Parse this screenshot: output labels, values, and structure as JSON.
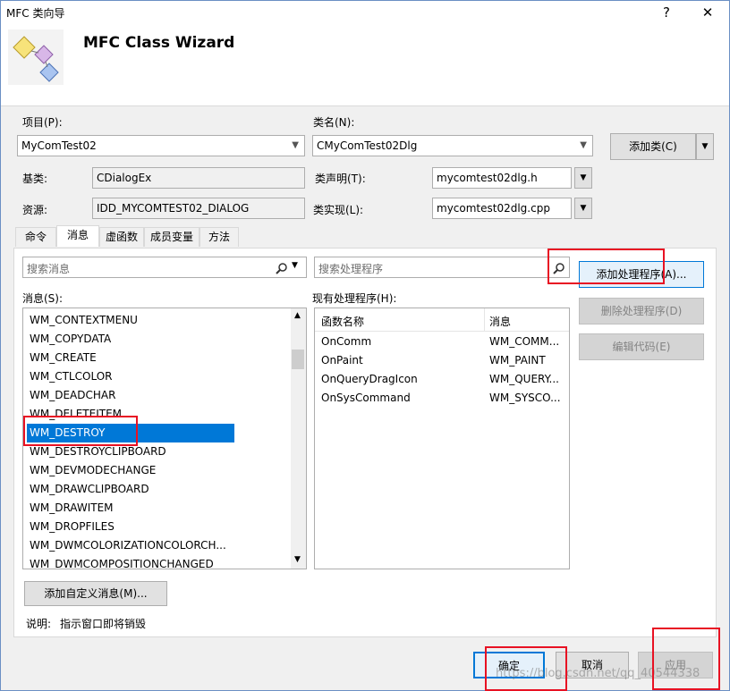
{
  "window": {
    "title": "MFC 类向导",
    "help": "?",
    "close": "✕"
  },
  "header": {
    "title": "MFC Class Wizard"
  },
  "project": {
    "label": "项目(P):",
    "value": "MyComTest02"
  },
  "classname": {
    "label": "类名(N):",
    "value": "CMyComTest02Dlg"
  },
  "add_class": {
    "label": "添加类(C)"
  },
  "base": {
    "label": "基类:",
    "value": "CDialogEx"
  },
  "class_decl": {
    "label": "类声明(T):",
    "value": "mycomtest02dlg.h"
  },
  "resource": {
    "label": "资源:",
    "value": "IDD_MYCOMTEST02_DIALOG"
  },
  "class_impl": {
    "label": "类实现(L):",
    "value": "mycomtest02dlg.cpp"
  },
  "tabs": [
    "命令",
    "消息",
    "虚函数",
    "成员变量",
    "方法"
  ],
  "search_messages": {
    "placeholder": "搜索消息"
  },
  "search_handlers": {
    "placeholder": "搜索处理程序"
  },
  "messages": {
    "label": "消息(S):",
    "items": [
      "WM_CONTEXTMENU",
      "WM_COPYDATA",
      "WM_CREATE",
      "WM_CTLCOLOR",
      "WM_DEADCHAR",
      "WM_DELETEITEM",
      "WM_DESTROY",
      "WM_DESTROYCLIPBOARD",
      "WM_DEVMODECHANGE",
      "WM_DRAWCLIPBOARD",
      "WM_DRAWITEM",
      "WM_DROPFILES",
      "WM_DWMCOLORIZATIONCOLORCH...",
      "WM_DWMCOMPOSITIONCHANGED"
    ],
    "selected": "WM_DESTROY"
  },
  "handlers": {
    "label": "现有处理程序(H):",
    "col_func": "函数名称",
    "col_msg": "消息",
    "rows": [
      {
        "func": "OnComm",
        "msg": "WM_COMM..."
      },
      {
        "func": "OnPaint",
        "msg": "WM_PAINT"
      },
      {
        "func": "OnQueryDragIcon",
        "msg": "WM_QUERY..."
      },
      {
        "func": "OnSysCommand",
        "msg": "WM_SYSCO..."
      }
    ]
  },
  "buttons": {
    "add_handler": "添加处理程序(A)...",
    "delete_handler": "删除处理程序(D)",
    "edit_code": "编辑代码(E)",
    "add_custom": "添加自定义消息(M)...",
    "ok": "确定",
    "cancel": "取消",
    "apply": "应用"
  },
  "description": {
    "label": "说明:",
    "text": "指示窗口即将销毁"
  },
  "watermark": "https://blog.csdn.net/qq_40544338",
  "colors": {
    "selection": "#0078d7",
    "highlight": "#e81123"
  }
}
